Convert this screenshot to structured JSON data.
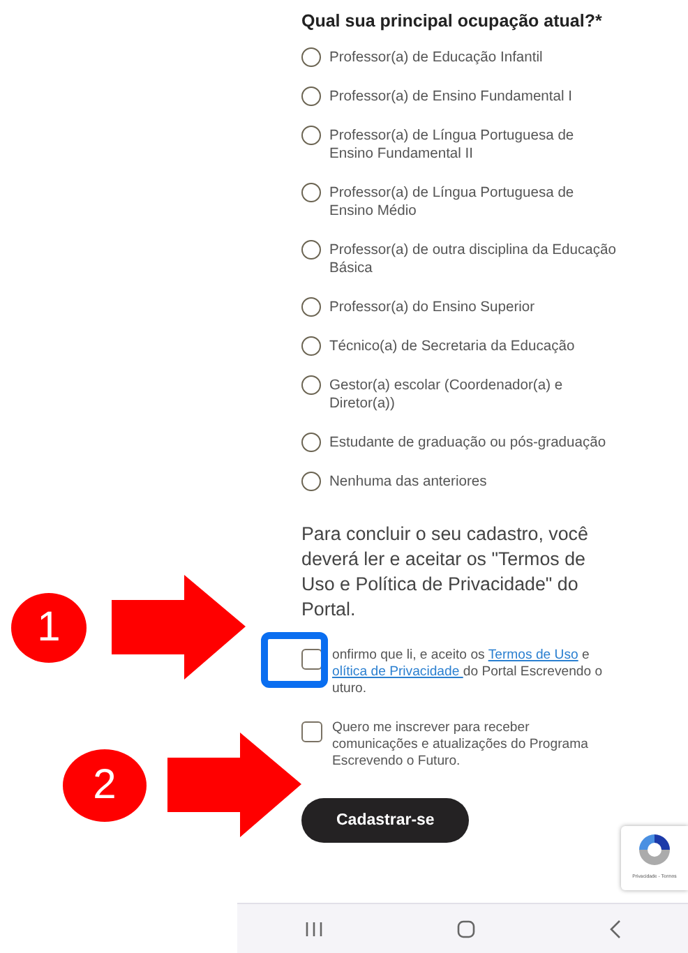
{
  "question": {
    "title": "Qual sua principal ocupação atual?*"
  },
  "options": [
    {
      "label": "Professor(a) de Educação Infantil",
      "selected": false
    },
    {
      "label": "Professor(a) de Ensino Fundamental I",
      "selected": false
    },
    {
      "label": "Professor(a) de Língua Portuguesa de Ensino Fundamental II",
      "selected": false
    },
    {
      "label": "Professor(a) de Língua Portuguesa de Ensino Médio",
      "selected": false
    },
    {
      "label": "Professor(a) de outra disciplina da Educação Básica",
      "selected": false
    },
    {
      "label": "Professor(a) do Ensino Superior",
      "selected": false
    },
    {
      "label": "Técnico(a) de Secretaria da Educação",
      "selected": false
    },
    {
      "label": "Gestor(a) escolar (Coordenador(a) e Diretor(a))",
      "selected": false
    },
    {
      "label": "Estudante de graduação ou pós-graduação",
      "selected": false
    },
    {
      "label": "Nenhuma das anteriores",
      "selected": false
    }
  ],
  "terms_intro": "Para concluir o seu cadastro, você deverá ler e aceitar os \"Termos de Uso e Política de Privacidade\" do Portal.",
  "checkboxes": [
    {
      "checked": false,
      "highlighted": true,
      "lines": [
        [
          {
            "kind": "text",
            "text": "onfirmo que li, e aceito os "
          },
          {
            "kind": "link",
            "text": "Termos de Uso"
          },
          {
            "kind": "text",
            "text": " e"
          }
        ],
        [
          {
            "kind": "link",
            "text": "olítica de Privacidade "
          },
          {
            "kind": "text",
            "text": "do Portal Escrevendo o"
          }
        ],
        [
          {
            "kind": "text",
            "text": "uturo."
          }
        ]
      ]
    },
    {
      "checked": false,
      "highlighted": false,
      "lines": [
        [
          {
            "kind": "text",
            "text": "Quero me inscrever para receber"
          }
        ],
        [
          {
            "kind": "text",
            "text": "comunicações e atualizações do Programa"
          }
        ],
        [
          {
            "kind": "text",
            "text": "Escrevendo o Futuro."
          }
        ]
      ]
    }
  ],
  "submit_button": {
    "label": "Cadastrar-se"
  },
  "recaptcha": {
    "links": "Privacidade - Termos"
  },
  "annotations": [
    {
      "number": "1"
    },
    {
      "number": "2"
    }
  ]
}
